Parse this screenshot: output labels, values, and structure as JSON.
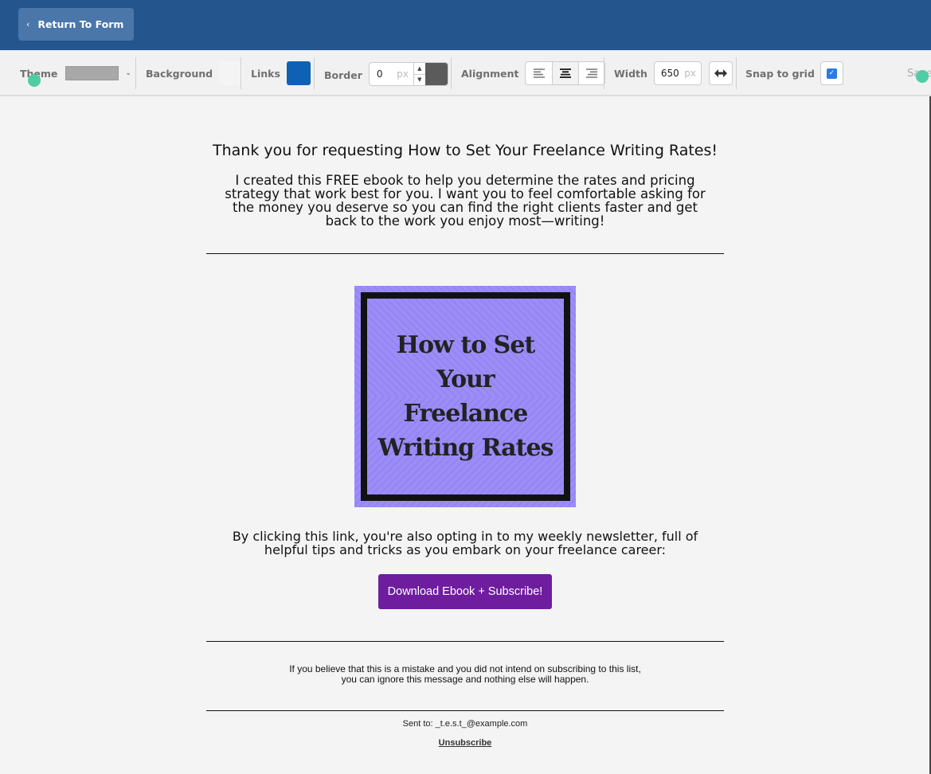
{
  "topbar": {
    "return_label": "Return To Form",
    "return_icon": "chevron-left-icon"
  },
  "toolbar": {
    "theme_label": "Theme",
    "theme_value_color": "#a8a8a8",
    "background_label": "Background",
    "background_color": "#f4f4f4",
    "links_label": "Links",
    "links_color": "#0f61b3",
    "border_label": "Border",
    "border_value": "0",
    "border_unit": "px",
    "border_color": "#5b5b5b",
    "alignment_label": "Alignment",
    "alignment_options": [
      "left",
      "center",
      "right"
    ],
    "alignment_selected": "center",
    "width_label": "Width",
    "width_value": "650",
    "width_unit": "px",
    "snap_label": "Snap to grid",
    "snap_checked": true,
    "save_label": "Save"
  },
  "email": {
    "heading": "Thank you for requesting How to Set Your Freelance Writing Rates!",
    "intro": "I created this FREE ebook to help you determine the rates and pricing strategy that work best for you. I want you to feel comfortable asking for the money you deserve so you can find the right clients faster and get back to the work you enjoy most—writing!",
    "cover": {
      "title_lines": [
        "How to Set",
        "Your",
        "Freelance",
        "Writing Rates"
      ],
      "bg_color": "#9b8cf8"
    },
    "optin_text": "By clicking this link, you're also opting in to my weekly newsletter, full of helpful tips and tricks as you embark on your freelance career:",
    "cta_label": "Download Ebook + Subscribe!",
    "cta_color": "#6f1d9f",
    "disclaimer_line1": "If you believe that this is a mistake and you did not intend on subscribing to this list,",
    "disclaimer_line2": "you can ignore this message and nothing else will happen.",
    "sent_to": "Sent to: _t.e.s.t_@example.com",
    "unsubscribe_label": "Unsubscribe"
  },
  "colors": {
    "topbar": "#24558c",
    "accent_dot": "#4fcca3"
  }
}
